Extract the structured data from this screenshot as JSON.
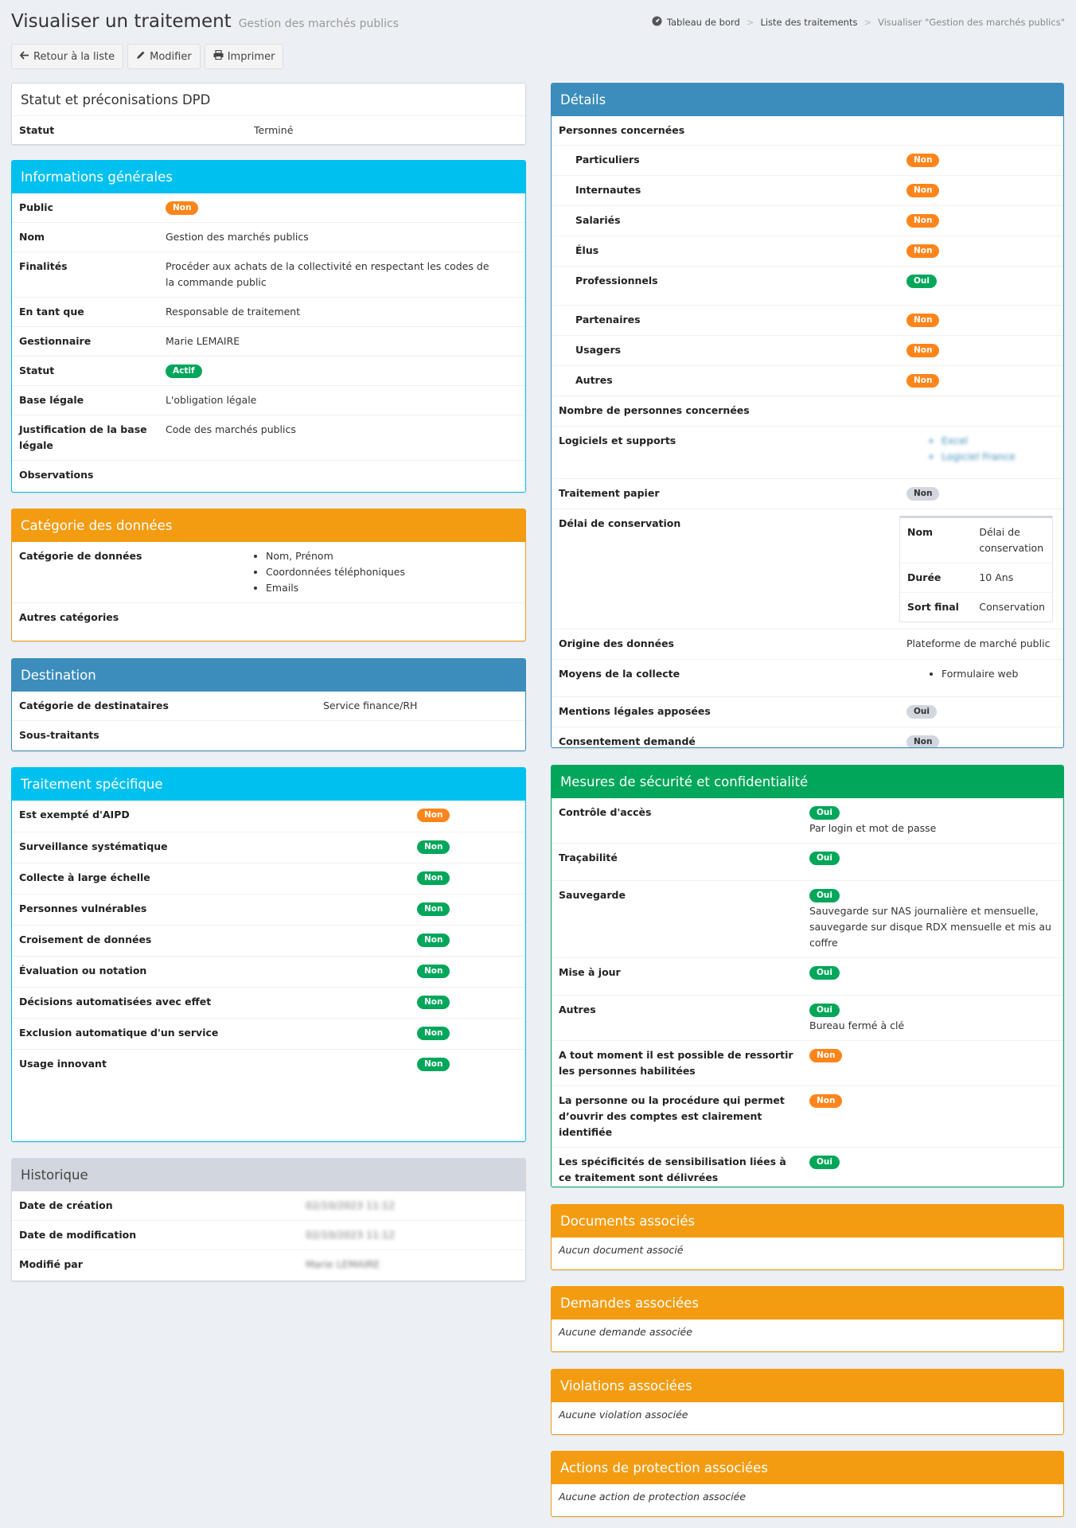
{
  "header": {
    "title": "Visualiser un traitement",
    "subtitle": "Gestion des marchés publics"
  },
  "breadcrumb": {
    "home": "Tableau de bord",
    "list": "Liste des traitements",
    "current": "Visualiser \"Gestion des marchés publics\""
  },
  "toolbar": {
    "back": "Retour à la liste",
    "edit": "Modifier",
    "print": "Imprimer"
  },
  "dpd": {
    "title": "Statut et préconisations DPD",
    "status_label": "Statut",
    "status_value": "Terminé"
  },
  "general": {
    "title": "Informations générales",
    "public_label": "Public",
    "public_value": "Non",
    "name_label": "Nom",
    "name_value": "Gestion des marchés publics",
    "finalites_label": "Finalités",
    "finalites_value": "Procéder aux achats de la collectivité en respectant les codes de la commande public",
    "entantque_label": "En tant que",
    "entantque_value": "Responsable de traitement",
    "gestionnaire_label": "Gestionnaire",
    "gestionnaire_value": "Marie LEMAIRE",
    "statut_label": "Statut",
    "statut_value": "Actif",
    "base_label": "Base légale",
    "base_value": "L'obligation légale",
    "justif_label": "Justification de la base légale",
    "justif_value": "Code des marchés publics",
    "obs_label": "Observations"
  },
  "categories": {
    "title": "Catégorie des données",
    "cat_label": "Catégorie de données",
    "items": [
      "Nom, Prénom",
      "Coordonnées téléphoniques",
      "Emails"
    ],
    "other_label": "Autres catégories"
  },
  "destination": {
    "title": "Destination",
    "dest_label": "Catégorie de destinataires",
    "dest_value": "Service finance/RH",
    "sub_label": "Sous-traitants"
  },
  "specific": {
    "title": "Traitement spécifique",
    "rows": [
      {
        "label": "Est exempté d'AIPD",
        "value": "Non",
        "color": "#ff851b"
      },
      {
        "label": "Surveillance systématique",
        "value": "Non",
        "color": "#00a65a"
      },
      {
        "label": "Collecte à large échelle",
        "value": "Non",
        "color": "#00a65a"
      },
      {
        "label": "Personnes vulnérables",
        "value": "Non",
        "color": "#00a65a"
      },
      {
        "label": "Croisement de données",
        "value": "Non",
        "color": "#00a65a"
      },
      {
        "label": "Évaluation ou notation",
        "value": "Non",
        "color": "#00a65a"
      },
      {
        "label": "Décisions automatisées avec effet",
        "value": "Non",
        "color": "#00a65a"
      },
      {
        "label": "Exclusion automatique d'un service",
        "value": "Non",
        "color": "#00a65a"
      },
      {
        "label": "Usage innovant",
        "value": "Non",
        "color": "#00a65a"
      }
    ]
  },
  "history": {
    "title": "Historique",
    "created_label": "Date de création",
    "created_value": "02/10/2023 11:12",
    "modified_label": "Date de modification",
    "modified_value": "02/10/2023 11:12",
    "by_label": "Modifié par",
    "by_value": "Marie LEMAIRE"
  },
  "details": {
    "title": "Détails",
    "persons_label": "Personnes concernées",
    "persons": [
      {
        "label": "Particuliers",
        "value": "Non"
      },
      {
        "label": "Internautes",
        "value": "Non"
      },
      {
        "label": "Salariés",
        "value": "Non"
      },
      {
        "label": "Élus",
        "value": "Non"
      },
      {
        "label": "Professionnels",
        "value": "Oui"
      },
      {
        "label": "Partenaires",
        "value": "Non"
      },
      {
        "label": "Usagers",
        "value": "Non"
      },
      {
        "label": "Autres",
        "value": "Non"
      }
    ],
    "count_label": "Nombre de personnes concernées",
    "software_label": "Logiciels et supports",
    "software": [
      "Excel",
      "Logiciel France"
    ],
    "paper_label": "Traitement papier",
    "paper_value": "Non",
    "retention_label": "Délai de conservation",
    "retention": {
      "name_label": "Nom",
      "name_value": "Délai de conservation",
      "duration_label": "Durée",
      "duration_value": "10 Ans",
      "final_label": "Sort final",
      "final_value": "Conservation"
    },
    "origin_label": "Origine des données",
    "origin_value": "Plateforme de marché public",
    "means_label": "Moyens de la collecte",
    "means": [
      "Formulaire web"
    ],
    "legal_label": "Mentions légales apposées",
    "legal_value": "Oui",
    "consent_label": "Consentement demandé",
    "consent_value": "Non"
  },
  "security": {
    "title": "Mesures de sécurité et confidentialité",
    "rows": [
      {
        "label": "Contrôle d'accès",
        "value": "Oui",
        "color": "#00a65a",
        "note": "Par login et mot de passe"
      },
      {
        "label": "Traçabilité",
        "value": "Oui",
        "color": "#00a65a",
        "note": ""
      },
      {
        "label": "Sauvegarde",
        "value": "Oui",
        "color": "#00a65a",
        "note": "Sauvegarde sur NAS journalière et mensuelle, sauvegarde sur disque RDX mensuelle et mis au coffre"
      },
      {
        "label": "Mise à jour",
        "value": "Oui",
        "color": "#00a65a",
        "note": ""
      },
      {
        "label": "Autres",
        "value": "Oui",
        "color": "#00a65a",
        "note": "Bureau fermé à clé"
      },
      {
        "label": "A tout moment il est possible de ressortir les personnes habilitées",
        "value": "Non",
        "color": "#ff851b",
        "note": ""
      },
      {
        "label": "La personne ou la procédure qui permet d’ouvrir des comptes est clairement identifiée",
        "value": "Non",
        "color": "#ff851b",
        "note": ""
      },
      {
        "label": "Les spécificités de sensibilisation liées à ce traitement sont délivrées",
        "value": "Oui",
        "color": "#00a65a",
        "note": ""
      }
    ]
  },
  "documents": {
    "title": "Documents associés",
    "empty": "Aucun document associé"
  },
  "requests": {
    "title": "Demandes associées",
    "empty": "Aucune demande associée"
  },
  "violations": {
    "title": "Violations associées",
    "empty": "Aucune violation associée"
  },
  "actions": {
    "title": "Actions de protection associées",
    "empty": "Aucune action de protection associée"
  }
}
